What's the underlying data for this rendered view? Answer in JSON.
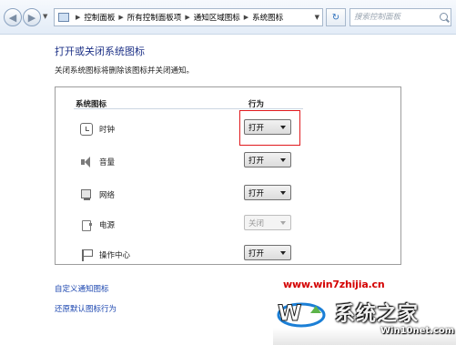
{
  "address_bar": {
    "breadcrumbs": [
      "控制面板",
      "所有控制面板项",
      "通知区域图标",
      "系统图标"
    ],
    "search_placeholder": "搜索控制面板"
  },
  "page": {
    "title": "打开或关闭系统图标",
    "description": "关闭系统图标将删除该图标并关闭通知。"
  },
  "table": {
    "header_icons": "系统图标",
    "header_behavior": "行为",
    "rows": [
      {
        "label": "时钟",
        "icon": "clock-icon",
        "value": "打开",
        "enabled": true
      },
      {
        "label": "音量",
        "icon": "volume-icon",
        "value": "打开",
        "enabled": true
      },
      {
        "label": "网络",
        "icon": "network-icon",
        "value": "打开",
        "enabled": true
      },
      {
        "label": "电源",
        "icon": "power-icon",
        "value": "关闭",
        "enabled": false
      },
      {
        "label": "操作中心",
        "icon": "flag-icon",
        "value": "打开",
        "enabled": true
      }
    ]
  },
  "links": {
    "customize": "自定义通知图标",
    "restore": "还原默认图标行为"
  },
  "watermark": {
    "url": "www.win7zhijia.cn",
    "brand": "系统之家",
    "domain": "Win10net.com"
  },
  "colors": {
    "highlight": "#e0191d",
    "link": "#1c47b0",
    "title": "#1e3287"
  }
}
